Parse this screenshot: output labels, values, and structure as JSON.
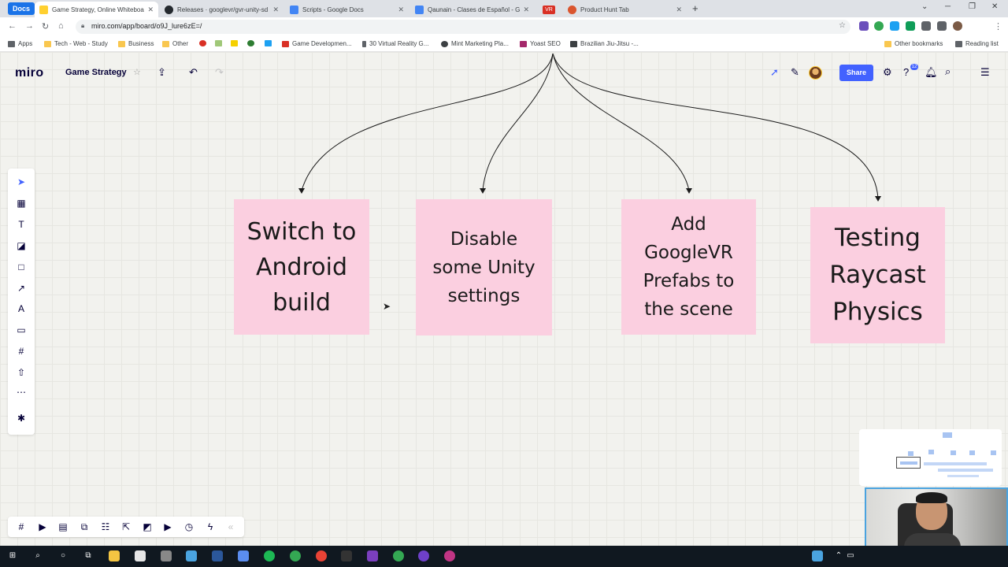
{
  "browser": {
    "docs_chip": "Docs",
    "tabs": [
      {
        "title": "Game Strategy, Online Whiteboa",
        "color": "#ffd02f"
      },
      {
        "title": "Releases · googlevr/gvr-unity-sd",
        "color": "#24292e"
      },
      {
        "title": "Scripts - Google Docs",
        "color": "#4285f4"
      },
      {
        "title": "Qaunain - Clases de Español - G",
        "color": "#4285f4"
      },
      {
        "title": "VR",
        "color": "#d93025"
      },
      {
        "title": "Product Hunt Tab",
        "color": "#da552f"
      }
    ],
    "url": "miro.com/app/board/o9J_lure6zE=/",
    "bookmarks": [
      "Apps",
      "Tech - Web - Study",
      "Business",
      "Other",
      "",
      "",
      "",
      "",
      "",
      "Game Developmen...",
      "30 Virtual Reality G...",
      "Mint Marketing Pla...",
      "Yoast SEO",
      "Brazilian Jiu-Jitsu -..."
    ],
    "other_bookmarks": "Other bookmarks",
    "reading_list": "Reading list"
  },
  "miro": {
    "logo": "miro",
    "board_name": "Game Strategy",
    "share_label": "Share",
    "notification_count": "12",
    "sticky_notes": [
      {
        "text": "Switch to Android build"
      },
      {
        "text": "Disable some Unity settings"
      },
      {
        "text": "Add GoogleVR Prefabs to the scene"
      },
      {
        "text": "Testing Raycast Physics"
      }
    ]
  },
  "colors": {
    "sticky": "#fbcfe0",
    "accent": "#4262ff",
    "canvas": "#f2f2ee"
  }
}
